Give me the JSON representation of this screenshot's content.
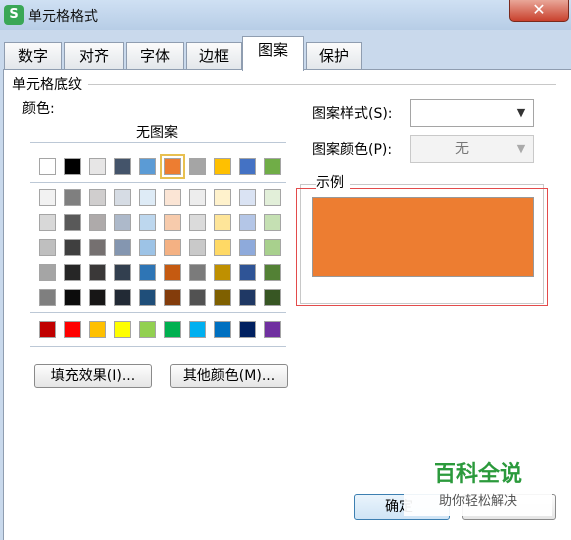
{
  "window": {
    "title": "单元格格式",
    "app_icon_glyph": "S",
    "close_glyph": "✕"
  },
  "tabs": [
    {
      "label": "数字"
    },
    {
      "label": "对齐"
    },
    {
      "label": "字体"
    },
    {
      "label": "边框"
    },
    {
      "label": "图案",
      "active": true
    },
    {
      "label": "保护"
    }
  ],
  "shading": {
    "group_title": "单元格底纹",
    "color_label": "颜色:",
    "no_pattern": "无图案",
    "selected_color": "#ed7d31",
    "theme_row": [
      "#ffffff",
      "#000000",
      "#e7e6e6",
      "#44546a",
      "#5b9bd5",
      "#ed7d31",
      "#a5a5a5",
      "#ffc000",
      "#4472c4",
      "#70ad47"
    ],
    "shade_rows": [
      [
        "#f2f2f2",
        "#7f7f7f",
        "#d0cece",
        "#d6dce4",
        "#deebf6",
        "#fbe5d5",
        "#ededed",
        "#fff2cc",
        "#dae3f3",
        "#e2efd9"
      ],
      [
        "#d8d8d8",
        "#595959",
        "#aeaaaa",
        "#adb9ca",
        "#bdd7ee",
        "#f7cbac",
        "#dbdbdb",
        "#fee599",
        "#b4c6e7",
        "#c5e0b3"
      ],
      [
        "#bfbfbf",
        "#3f3f3f",
        "#757070",
        "#8496b0",
        "#9dc3e6",
        "#f4b183",
        "#c9c9c9",
        "#ffd965",
        "#8eaadb",
        "#a8d08d"
      ],
      [
        "#a5a5a5",
        "#262626",
        "#3a3838",
        "#323f4f",
        "#2e75b5",
        "#c55a11",
        "#7b7b7b",
        "#bf9000",
        "#2f5496",
        "#538135"
      ],
      [
        "#7f7f7f",
        "#0c0c0c",
        "#171616",
        "#222a35",
        "#1f4e79",
        "#833c0b",
        "#525252",
        "#7f6000",
        "#1f3864",
        "#375623"
      ]
    ],
    "standard_row": [
      "#c00000",
      "#ff0000",
      "#ffc000",
      "#ffff00",
      "#92d050",
      "#00b050",
      "#00b0f0",
      "#0070c0",
      "#002060",
      "#7030a0"
    ],
    "fill_effects_button": "填充效果(I)...",
    "more_colors_button": "其他颜色(M)..."
  },
  "pattern": {
    "style_label": "图案样式(S):",
    "style_value": "",
    "color_label": "图案颜色(P):",
    "color_value": "无"
  },
  "example": {
    "title": "示例"
  },
  "footer": {
    "ok_label": "确定"
  },
  "watermark": {
    "line1": "百科全说",
    "line2": "助你轻松解决"
  }
}
